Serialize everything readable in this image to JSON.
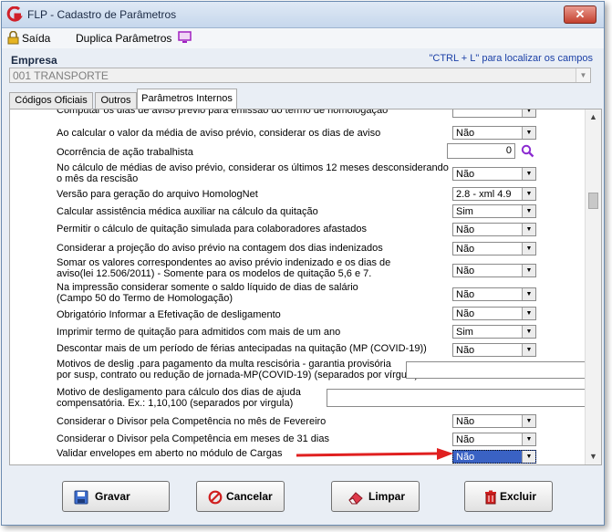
{
  "window": {
    "title": "FLP - Cadastro de Parâmetros",
    "close_glyph": "✕"
  },
  "toolbar": {
    "saida_label": "Saída",
    "duplica_label": "Duplica Parâmetros"
  },
  "empresa": {
    "label": "Empresa",
    "hint": "\"CTRL + L\" para localizar os campos",
    "value": "001 TRANSPORTE"
  },
  "tabs": [
    {
      "label": "Códigos Oficiais"
    },
    {
      "label": "Outros"
    },
    {
      "label": "Parâmetros Internos"
    }
  ],
  "rows": {
    "r0": {
      "label": "Computar os dias de aviso prévio para emissão do termo de homologação"
    },
    "r1": {
      "label": "Ao calcular o valor da média de aviso prévio, considerar os dias de aviso",
      "value": "Não"
    },
    "r2": {
      "label": "Ocorrência de ação trabalhista",
      "value": "0"
    },
    "r3": {
      "label": "No cálculo de médias de aviso prévio, considerar os últimos 12 meses desconsiderando\no mês da rescisão",
      "value": "Não"
    },
    "r4": {
      "label": "Versão para geração do arquivo HomologNet",
      "value": "2.8 - xml 4.9"
    },
    "r5": {
      "label": "Calcular assistência médica auxiliar na cálculo da quitação",
      "value": "Sim"
    },
    "r6": {
      "label": "Permitir o cálculo de quitação simulada para colaboradores afastados",
      "value": "Não"
    },
    "r7": {
      "label": "Considerar a projeção do aviso prévio na contagem dos dias indenizados",
      "value": "Não"
    },
    "r8": {
      "label": "Somar os valores correspondentes ao aviso prévio indenizado e os dias de\naviso(lei 12.506/2011)  - Somente para os modelos de quitação 5,6 e 7.",
      "value": "Não"
    },
    "r9": {
      "label": "Na impressão considerar somente o saldo líquido de dias de salário\n(Campo 50 do Termo de Homologação)",
      "value": "Não"
    },
    "r10": {
      "label": "Obrigatório Informar a Efetivação de desligamento",
      "value": "Não"
    },
    "r11": {
      "label": "Imprimir termo de quitação para admitidos com mais de um ano",
      "value": "Sim"
    },
    "r12": {
      "label": "Descontar mais de um período de férias antecipadas na quitação (MP (COVID-19))",
      "value": "Não"
    },
    "r13": {
      "label": "Motivos de deslig .para pagamento da multa rescisória - garantia provisória\npor susp, contrato ou redução de jornada-MP(COVID-19) (separados por vírgula)",
      "value": ""
    },
    "r14": {
      "label": "Motivo de desligamento para cálculo dos dias de ajuda\ncompensatória. Ex.: 1,10,100 (separados por virgula)",
      "value": ""
    },
    "r15": {
      "label": "Considerar o Divisor pela Competência no mês de Fevereiro",
      "value": "Não"
    },
    "r16": {
      "label": "Considerar o Divisor pela Competência em meses de 31 dias",
      "value": "Não"
    },
    "r17": {
      "label": "Validar envelopes em aberto no módulo de Cargas",
      "value": "Não"
    }
  },
  "buttons": {
    "gravar": "Gravar",
    "cancelar": "Cancelar",
    "limpar": "Limpar",
    "excluir": "Excluir"
  },
  "colors": {
    "accent": "#3a62c4",
    "arrow": "#e02020",
    "hint": "#1a3fa6"
  }
}
